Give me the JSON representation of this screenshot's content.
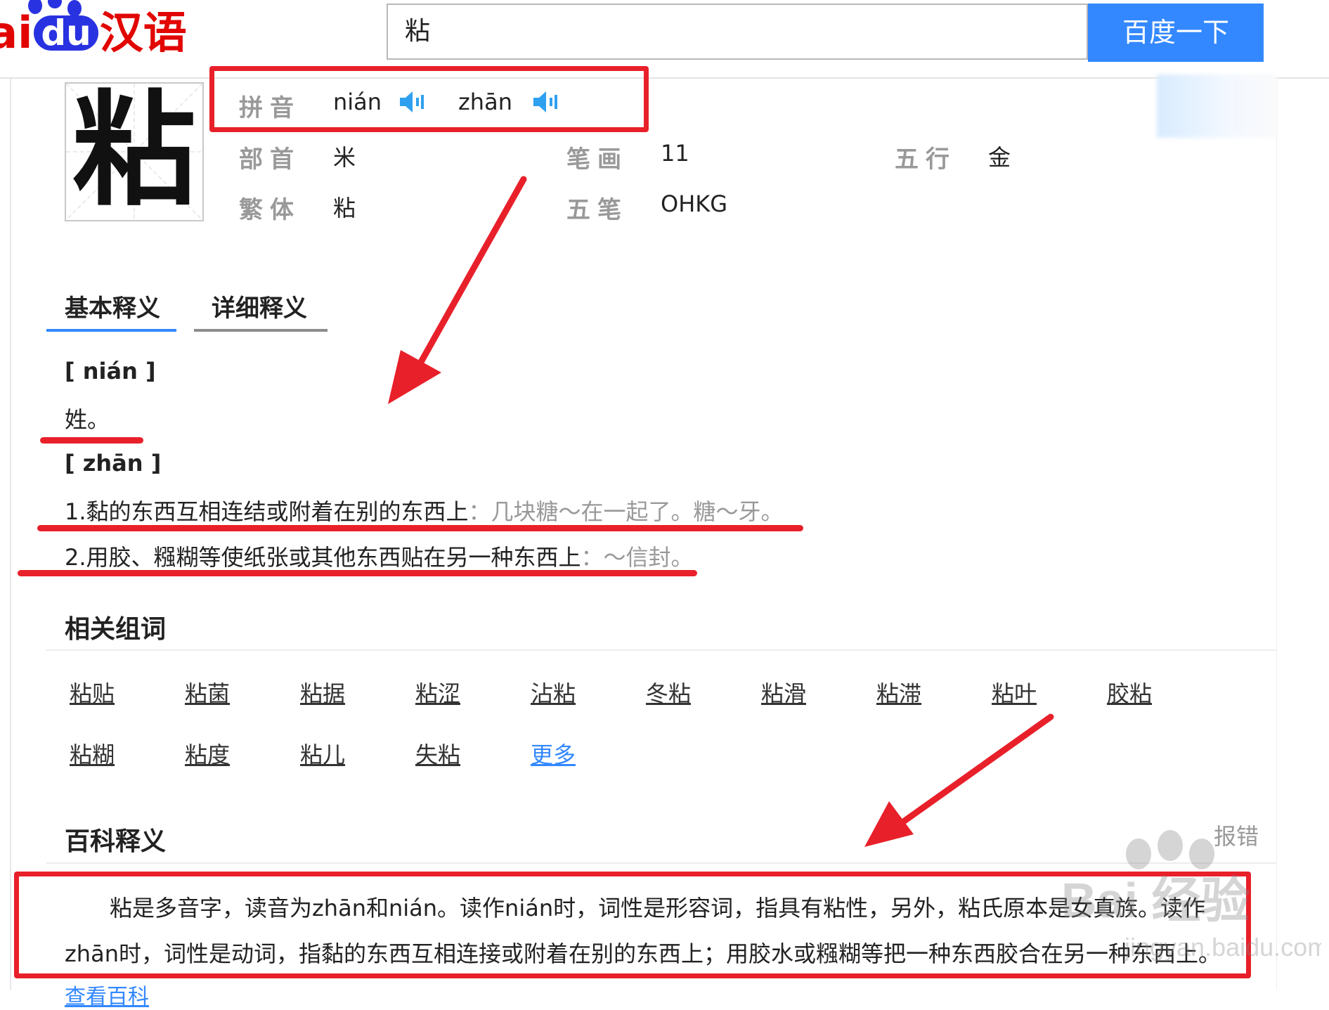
{
  "header": {
    "logo_bai": "Bai",
    "logo_du": "du",
    "logo_hanyu": "汉语",
    "search_value": "粘",
    "search_button": "百度一下"
  },
  "character": {
    "glyph": "粘",
    "pinyin_label": "拼音",
    "pinyin_1": "nián",
    "pinyin_2": "zhān",
    "radical_label": "部首",
    "radical": "米",
    "strokes_label": "笔画",
    "strokes": "11",
    "wuxing_label": "五行",
    "wuxing": "金",
    "traditional_label": "繁体",
    "traditional": "粘",
    "wubi_label": "五笔",
    "wubi": "OHKG"
  },
  "tabs": {
    "basic": "基本释义",
    "detailed": "详细释义"
  },
  "definitions": {
    "nian_head": "[ nián ]",
    "nian_def": "姓。",
    "zhan_head": "[ zhān ]",
    "zhan_1_main": "1.黏的东西互相连结或附着在别的东西上",
    "zhan_1_example": "：几块糖～在一起了。糖～牙。",
    "zhan_2_main": "2.用胶、糨糊等使纸张或其他东西贴在另一种东西上",
    "zhan_2_example": "：～信封。"
  },
  "related_words": {
    "title": "相关组词",
    "row1": [
      "粘贴",
      "粘菌",
      "粘据",
      "粘涩",
      "沾粘",
      "冬粘",
      "粘滑",
      "粘滞",
      "粘叶",
      "胶粘"
    ],
    "row2": [
      "粘糊",
      "粘度",
      "粘儿",
      "失粘"
    ],
    "more": "更多"
  },
  "baike": {
    "title": "百科释义",
    "report": "报错",
    "line1": "粘是多音字，读音为zhān和nián。读作nián时，词性是形容词，指具有粘性，另外，粘氏原本是女真族。读作",
    "line2": "zhān时，词性是动词，指黏的东西互相连接或附着在别的东西上；用胶水或糨糊等把一种东西胶合在另一种东西上。",
    "more_link": "查看百科"
  },
  "watermark": {
    "text": "Bai 经验",
    "url": "jingyan.baidu.com"
  },
  "colors": {
    "brand_red": "#e10602",
    "button_blue": "#3388ff",
    "annotation_red": "#e8202a"
  }
}
